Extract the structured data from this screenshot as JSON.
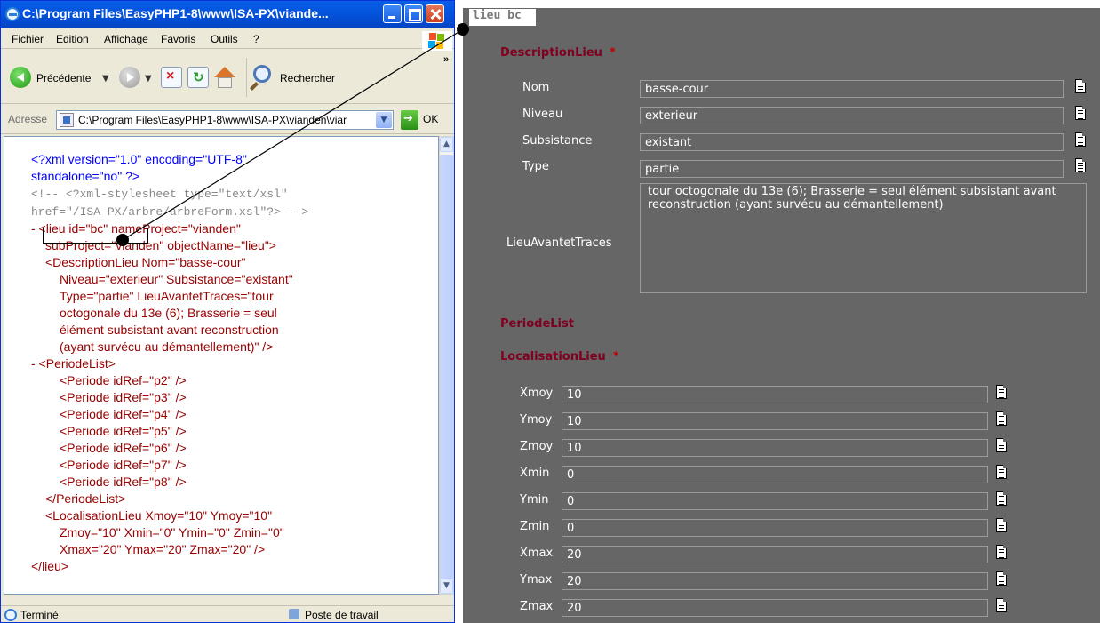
{
  "window": {
    "title": "C:\\Program Files\\EasyPHP1-8\\www\\ISA-PX\\viande...",
    "menu": [
      "Fichier",
      "Edition",
      "Affichage",
      "Favoris",
      "Outils",
      "?"
    ],
    "toolbar": {
      "back_label": "Précédente",
      "search_label": "Rechercher",
      "more": "»"
    },
    "address": {
      "label": "Adresse",
      "value": "C:\\Program Files\\EasyPHP1-8\\www\\ISA-PX\\vianden\\viar",
      "go_label": "OK"
    },
    "status": {
      "text": "Terminé",
      "zone": "Poste de travail"
    }
  },
  "xml_lines": [
    "<?xml version=\"1.0\" encoding=\"UTF-8\"",
    "standalone=\"no\" ?>",
    "<!-- <?xml-stylesheet type=\"text/xsl\"",
    "href=\"/ISA-PX/arbre/arbreForm.xsl\"?> -->",
    "- <lieu id=\"bc\" nameProject=\"vianden\"",
    "subProject=\"vianden\" objectName=\"lieu\">",
    "<DescriptionLieu Nom=\"basse-cour\"",
    "Niveau=\"exterieur\" Subsistance=\"existant\"",
    "Type=\"partie\" LieuAvantetTraces=\"tour",
    "octogonale du 13e (6); Brasserie = seul",
    "élément subsistant avant reconstruction",
    "(ayant survécu au démantellement)\" />",
    "- <PeriodeList>",
    "<Periode idRef=\"p2\" />",
    "<Periode idRef=\"p3\" />",
    "<Periode idRef=\"p4\" />",
    "<Periode idRef=\"p5\" />",
    "<Periode idRef=\"p6\" />",
    "<Periode idRef=\"p7\" />",
    "<Periode idRef=\"p8\" />",
    "</PeriodeList>",
    "<LocalisationLieu Xmoy=\"10\" Ymoy=\"10\"",
    "Zmoy=\"10\" Xmin=\"0\" Ymin=\"0\" Zmin=\"0\"",
    "Xmax=\"20\" Ymax=\"20\" Zmax=\"20\" />",
    "</lieu>"
  ],
  "form": {
    "tab_label": "lieu bc",
    "description_section": "DescriptionLieu",
    "required_mark": "*",
    "description_fields": [
      {
        "label": "Nom",
        "value": "basse-cour"
      },
      {
        "label": "Niveau",
        "value": "exterieur"
      },
      {
        "label": "Subsistance",
        "value": "existant"
      },
      {
        "label": "Type",
        "value": "partie"
      }
    ],
    "traces": {
      "label": "LieuAvantetTraces",
      "value": "tour octogonale du 13e (6); Brasserie = seul élément subsistant avant reconstruction (ayant survécu au démantellement)"
    },
    "periode_section": "PeriodeList",
    "localisation_section": "LocalisationLieu",
    "localisation_fields": [
      {
        "label": "Xmoy",
        "value": "10"
      },
      {
        "label": "Ymoy",
        "value": "10"
      },
      {
        "label": "Zmoy",
        "value": "10"
      },
      {
        "label": "Xmin",
        "value": "0"
      },
      {
        "label": "Ymin",
        "value": "0"
      },
      {
        "label": "Zmin",
        "value": "0"
      },
      {
        "label": "Xmax",
        "value": "20"
      },
      {
        "label": "Ymax",
        "value": "20"
      },
      {
        "label": "Zmax",
        "value": "20"
      }
    ]
  },
  "colors": {
    "title_blue": "#0453dd",
    "panel_gray": "#666666",
    "section_red": "#800020",
    "xml_blue": "#0000ff",
    "xml_red": "#990000"
  }
}
